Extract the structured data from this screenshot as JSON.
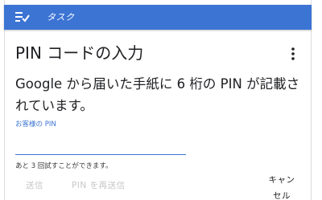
{
  "colors": {
    "accent": "#3c74d4",
    "text": "#202124",
    "disabled": "#c6c6c6"
  },
  "header": {
    "icon": "task-list-icon",
    "title": "タスク"
  },
  "card": {
    "title": "PIN コードの入力",
    "menu_icon": "more-vert-icon",
    "description": "Google から届いた手紙に 6 桁の PIN が記載されています。",
    "pin_field": {
      "label": "お客様の PIN",
      "value": ""
    },
    "attempts_text": "あと 3 回試すことができます。"
  },
  "actions": {
    "send_label": "送信",
    "resend_label": "PIN を再送信",
    "cancel_label_line1": "キャン",
    "cancel_label_line2": "セル"
  }
}
